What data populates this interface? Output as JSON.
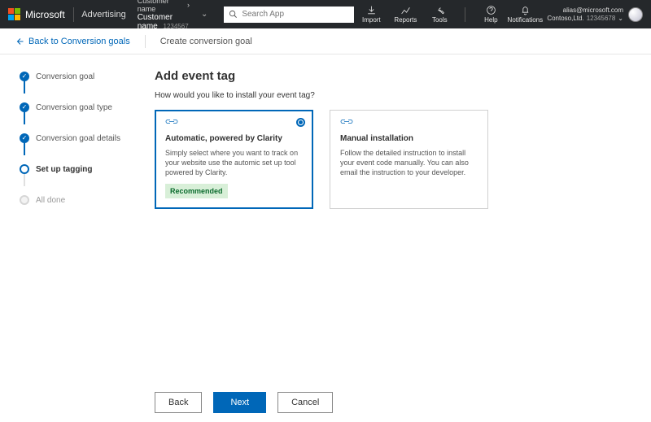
{
  "header": {
    "brand": "Microsoft",
    "product": "Advertising",
    "customer_line1": "Customer name",
    "customer_line2": "Customer name",
    "customer_number": "1234567",
    "search_placeholder": "Search App",
    "tools": {
      "import": "Import",
      "reports": "Reports",
      "tools": "Tools",
      "help": "Help",
      "notifications": "Notifications"
    },
    "account_email": "alias@microsoft.com",
    "account_name": "Contoso,Ltd.",
    "account_number": "12345678"
  },
  "subheader": {
    "back": "Back to Conversion goals",
    "title": "Create conversion goal"
  },
  "steps": {
    "s1": "Conversion goal",
    "s2": "Conversion goal type",
    "s3": "Conversion goal details",
    "s4": "Set up tagging",
    "s5": "All done"
  },
  "main": {
    "heading": "Add event tag",
    "prompt": "How would you like to install your event tag?",
    "card1": {
      "title": "Automatic, powered by Clarity",
      "desc": "Simply select where you want to track on your website use the automic set up tool powered by Clarity.",
      "badge": "Recommended"
    },
    "card2": {
      "title": "Manual installation",
      "desc": "Follow the detailed instruction to install your event code manually. You can also email the instruction to your developer."
    }
  },
  "footer": {
    "back": "Back",
    "next": "Next",
    "cancel": "Cancel"
  }
}
